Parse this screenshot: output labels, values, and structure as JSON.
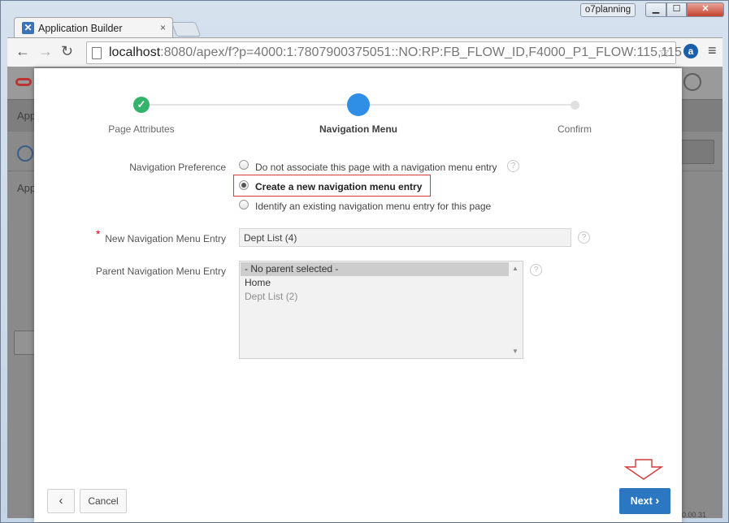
{
  "browser": {
    "tab_title": "Application Builder",
    "tab_close": "×",
    "user_badge": "o7planning",
    "win_min": "▁",
    "win_max": "☐",
    "win_close": "✕",
    "url_host": "localhost",
    "url_rest": ":8080/apex/f?p=4000:1:7807900375051::NO:RP:FB_FLOW_ID,F4000_P1_FLOW:115,115",
    "back_glyph": "←",
    "forward_glyph": "→",
    "reload_glyph": "↻",
    "star_glyph": "☆",
    "ext_label": "a",
    "menu_glyph": "≡"
  },
  "background": {
    "tab_fragment": "App",
    "row_fragment": "App",
    "status_fragment": "0.00.31"
  },
  "wizard": {
    "steps": [
      {
        "label": "Page Attributes",
        "state": "done",
        "mark": "✓"
      },
      {
        "label": "Navigation Menu",
        "state": "current"
      },
      {
        "label": "Confirm",
        "state": "pending"
      }
    ]
  },
  "form": {
    "nav_pref_label": "Navigation Preference",
    "nav_options": [
      {
        "label": "Do not associate this page with a navigation menu entry",
        "checked": false
      },
      {
        "label": "Create a new navigation menu entry",
        "checked": true
      },
      {
        "label": "Identify an existing navigation menu entry for this page",
        "checked": false
      }
    ],
    "required_mark": "*",
    "new_entry_label": "New Navigation Menu Entry",
    "new_entry_value": "Dept List (4)",
    "parent_label": "Parent Navigation Menu Entry",
    "parent_options": [
      {
        "label": "- No parent selected -",
        "selected": true
      },
      {
        "label": "Home",
        "selected": false
      },
      {
        "label": "Dept List (2)",
        "selected": false
      }
    ],
    "help_glyph": "?"
  },
  "footer": {
    "back_glyph": "‹",
    "cancel_label": "Cancel",
    "next_label": "Next",
    "next_glyph": "›"
  },
  "colors": {
    "accent": "#2b77c2",
    "step_done": "#34b36b",
    "step_current": "#2f8ee5",
    "highlight": "#d33a3a"
  }
}
